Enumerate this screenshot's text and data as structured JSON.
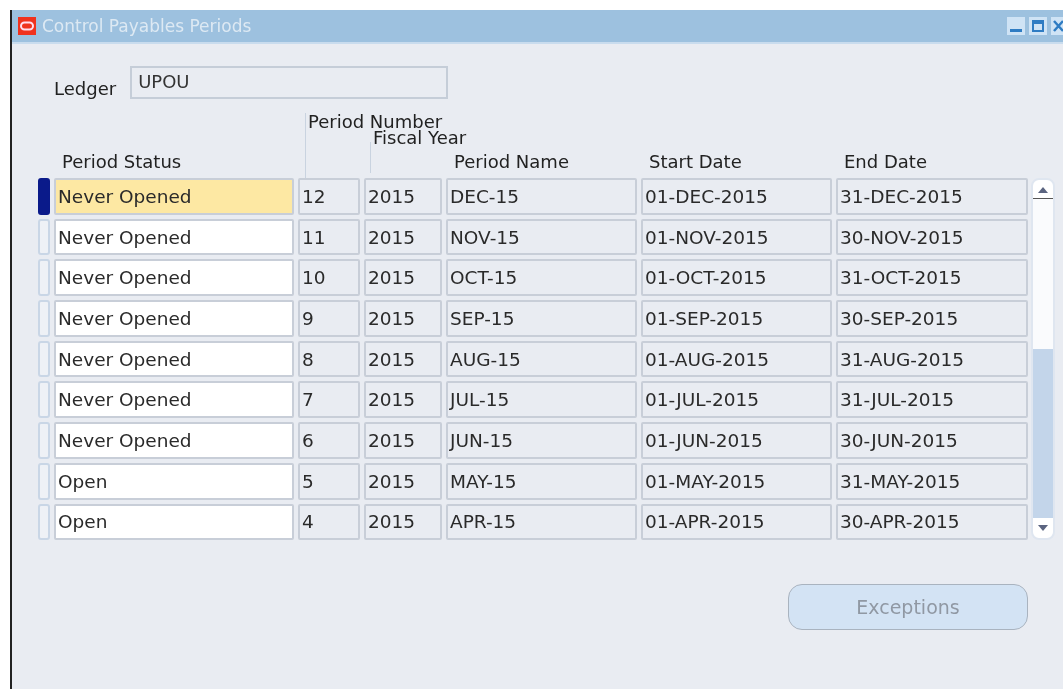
{
  "window": {
    "title": "Control Payables Periods"
  },
  "ledger": {
    "label": "Ledger",
    "value": "UPOU"
  },
  "columns": {
    "period_number": "Period Number",
    "fiscal_year": "Fiscal Year",
    "period_status": "Period Status",
    "period_name": "Period Name",
    "start_date": "Start Date",
    "end_date": "End Date"
  },
  "rows": [
    {
      "selected": true,
      "status": "Never Opened",
      "number": "12",
      "year": "2015",
      "name": "DEC-15",
      "start": "01-DEC-2015",
      "end": "31-DEC-2015"
    },
    {
      "selected": false,
      "status": "Never Opened",
      "number": "11",
      "year": "2015",
      "name": "NOV-15",
      "start": "01-NOV-2015",
      "end": "30-NOV-2015"
    },
    {
      "selected": false,
      "status": "Never Opened",
      "number": "10",
      "year": "2015",
      "name": "OCT-15",
      "start": "01-OCT-2015",
      "end": "31-OCT-2015"
    },
    {
      "selected": false,
      "status": "Never Opened",
      "number": "9",
      "year": "2015",
      "name": "SEP-15",
      "start": "01-SEP-2015",
      "end": "30-SEP-2015"
    },
    {
      "selected": false,
      "status": "Never Opened",
      "number": "8",
      "year": "2015",
      "name": "AUG-15",
      "start": "01-AUG-2015",
      "end": "31-AUG-2015"
    },
    {
      "selected": false,
      "status": "Never Opened",
      "number": "7",
      "year": "2015",
      "name": "JUL-15",
      "start": "01-JUL-2015",
      "end": "31-JUL-2015"
    },
    {
      "selected": false,
      "status": "Never Opened",
      "number": "6",
      "year": "2015",
      "name": "JUN-15",
      "start": "01-JUN-2015",
      "end": "30-JUN-2015"
    },
    {
      "selected": false,
      "status": "Open",
      "number": "5",
      "year": "2015",
      "name": "MAY-15",
      "start": "01-MAY-2015",
      "end": "31-MAY-2015"
    },
    {
      "selected": false,
      "status": "Open",
      "number": "4",
      "year": "2015",
      "name": "APR-15",
      "start": "01-APR-2015",
      "end": "30-APR-2015"
    }
  ],
  "exceptions_button": {
    "label": "Exceptions",
    "disabled": true
  }
}
